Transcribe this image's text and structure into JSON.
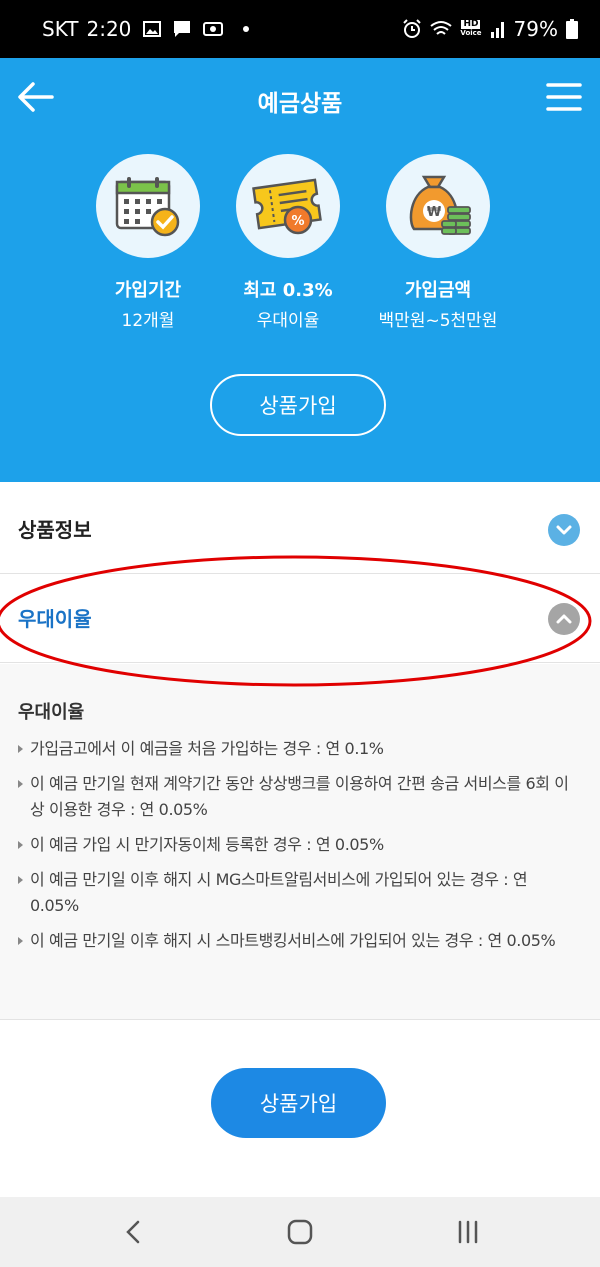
{
  "status_bar": {
    "carrier": "SKT",
    "time": "2:20",
    "battery": "79%",
    "icons": [
      "gallery-icon",
      "message-icon",
      "notification-icon",
      "alarm-icon",
      "wifi-icon",
      "hd-voice-icon",
      "signal-icon",
      "battery-icon"
    ],
    "hd_label_top": "HD",
    "hd_label_bottom": "Voice"
  },
  "header": {
    "title": "예금상품",
    "back_icon": "arrow-left-icon",
    "menu_icon": "hamburger-menu-icon",
    "background_color": "#1da1ea"
  },
  "features": [
    {
      "icon": "calendar-check-icon",
      "title": "가입기간",
      "value": "12개월"
    },
    {
      "icon": "rate-ticket-icon",
      "title": "최고 0.3%",
      "value": "우대이율"
    },
    {
      "icon": "money-bag-icon",
      "title": "가입금액",
      "value": "백만원~5천만원"
    }
  ],
  "ticket_percent": "%",
  "money_symbol": "₩",
  "join_button_top": "상품가입",
  "accordion": {
    "info": {
      "label": "상품정보",
      "expanded": false
    },
    "rate": {
      "label": "우대이율",
      "expanded": true
    }
  },
  "rate_panel": {
    "title": "우대이율",
    "items": [
      "가입금고에서 이 예금을 처음 가입하는 경우 : 연 0.1%",
      "이 예금 만기일 현재 계약기간 동안 상상뱅크를 이용하여 간편 송금 서비스를 6회 이상 이용한 경우 : 연 0.05%",
      "이 예금 가입 시 만기자동이체 등록한 경우 : 연 0.05%",
      "이 예금 만기일 이후 해지 시 MG스마트알림서비스에 가입되어 있는 경우 : 연 0.05%",
      "이 예금 만기일 이후 해지 시 스마트뱅킹서비스에 가입되어 있는 경우 : 연 0.05%"
    ]
  },
  "join_button_bottom": "상품가입",
  "nav_bar": {
    "icons": [
      "nav-back-icon",
      "nav-home-icon",
      "nav-recent-apps-icon"
    ]
  },
  "colors": {
    "accent_blue": "#1da1ea",
    "button_blue": "#1d89e4",
    "link_blue": "#1a73c6",
    "highlight_red": "#e00000"
  }
}
